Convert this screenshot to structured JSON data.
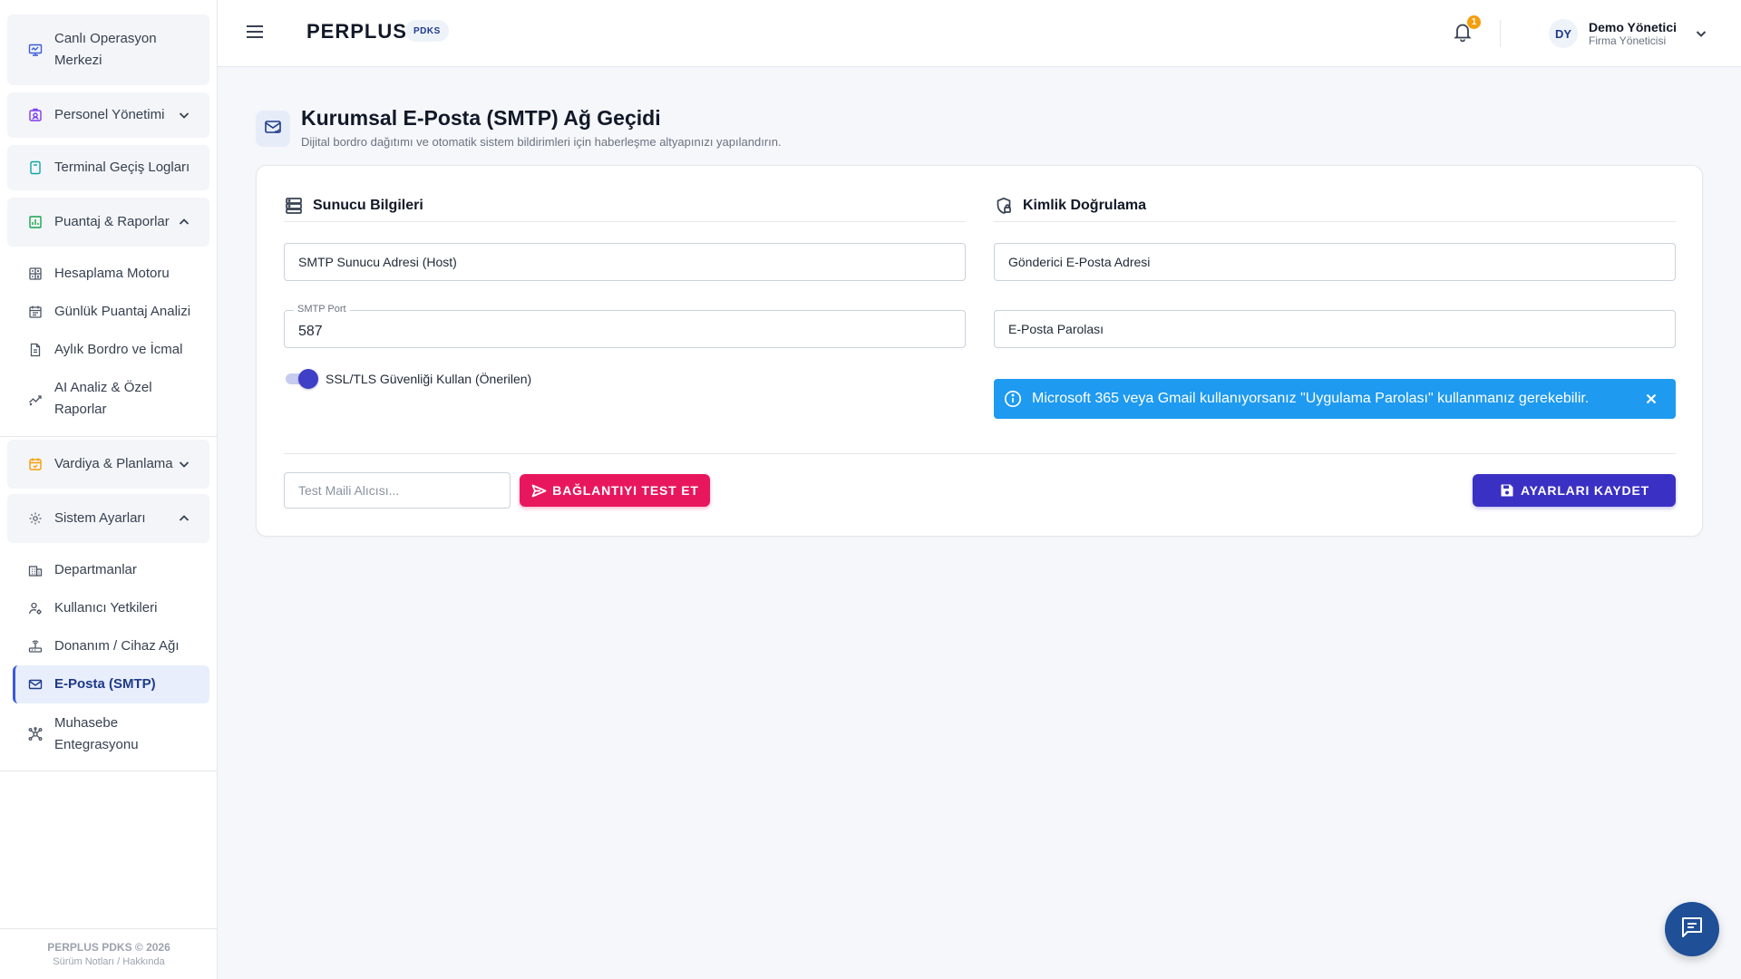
{
  "app": {
    "brand": "PERPLUS",
    "brand_badge": "PDKS",
    "notification_count": "1"
  },
  "user": {
    "initials": "DY",
    "name": "Demo Yönetici",
    "role": "Firma Yöneticisi"
  },
  "sidebar": {
    "groups": [
      {
        "label": "Canlı Operasyon Merkezi",
        "icon": "monitor-icon"
      },
      {
        "label": "Personel Yönetimi",
        "icon": "id-badge-icon",
        "expanded": false
      },
      {
        "label": "Terminal Geçiş Logları",
        "icon": "terminal-icon"
      },
      {
        "label": "Puantaj & Raporlar",
        "icon": "chart-icon",
        "expanded": true
      },
      {
        "label": "Vardiya & Planlama",
        "icon": "calendar-icon",
        "expanded": false
      },
      {
        "label": "Sistem Ayarları",
        "icon": "gear-icon",
        "expanded": true
      }
    ],
    "puantaj_items": [
      {
        "label": "Hesaplama Motoru",
        "icon": "calculator-icon"
      },
      {
        "label": "Günlük Puantaj Analizi",
        "icon": "daily-calendar-icon"
      },
      {
        "label": "Aylık Bordro ve İcmal",
        "icon": "document-icon"
      },
      {
        "label": "AI Analiz & Özel Raporlar",
        "icon": "trend-icon"
      }
    ],
    "system_items": [
      {
        "label": "Departmanlar",
        "icon": "building-icon"
      },
      {
        "label": "Kullanıcı Yetkileri",
        "icon": "user-permissions-icon"
      },
      {
        "label": "Donanım / Cihaz Ağı",
        "icon": "router-icon"
      },
      {
        "label": "E-Posta (SMTP)",
        "icon": "mail-icon",
        "active": true
      },
      {
        "label": "Muhasebe Entegrasyonu",
        "icon": "hub-icon"
      }
    ],
    "footer_title": "PERPLUS PDKS © 2026",
    "footer_links": "Sürüm Notları / Hakkında"
  },
  "page": {
    "title": "Kurumsal E-Posta (SMTP) Ağ Geçidi",
    "subtitle": "Dijital bordro dağıtımı ve otomatik sistem bildirimleri için haberleşme altyapınızı yapılandırın."
  },
  "server": {
    "heading": "Sunucu Bilgileri",
    "host_label": "SMTP Sunucu Adresi (Host)",
    "port_label": "SMTP Port",
    "port_value": "587",
    "ssl_label": "SSL/TLS Güvenliği Kullan (Önerilen)",
    "ssl_enabled": true
  },
  "auth": {
    "heading": "Kimlik Doğrulama",
    "sender_label": "Gönderici E-Posta Adresi",
    "password_label": "E-Posta Parolası",
    "info_text": "Microsoft 365 veya Gmail kullanıyorsanız \"Uygulama Parolası\" kullanmanız gerekebilir."
  },
  "actions": {
    "test_placeholder": "Test Maili Alıcısı...",
    "test_button": "BAĞLANTIYI TEST ET",
    "save_button": "AYARLARI KAYDET"
  },
  "colors": {
    "accent": "#3b30c4",
    "test_button": "#e8175d",
    "info": "#1e9af0",
    "active_nav": "#3b5bdb",
    "fab": "#1e4f97"
  }
}
